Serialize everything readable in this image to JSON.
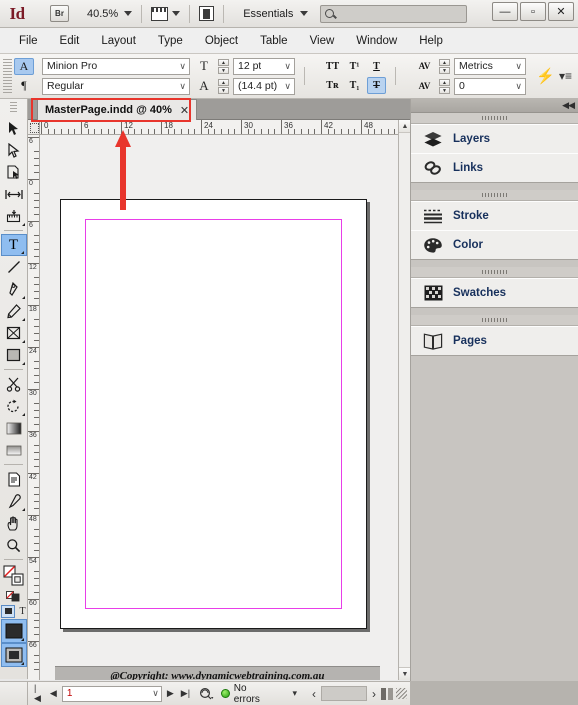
{
  "app": {
    "name": "Id",
    "bridge_label": "Br",
    "zoom_level": "40.5%",
    "workspace": "Essentials",
    "search_placeholder": ""
  },
  "window_controls": {
    "minimize": "—",
    "maximize": "▫",
    "close": "✕"
  },
  "menubar": {
    "items": [
      {
        "label": "File"
      },
      {
        "label": "Edit"
      },
      {
        "label": "Layout"
      },
      {
        "label": "Type"
      },
      {
        "label": "Object"
      },
      {
        "label": "Table"
      },
      {
        "label": "View"
      },
      {
        "label": "Window"
      },
      {
        "label": "Help"
      }
    ]
  },
  "control_panel": {
    "char_mode": "A",
    "para_mode": "¶",
    "font_family": "Minion Pro",
    "font_style": "Regular",
    "font_size": "12 pt",
    "leading": "(14.4 pt)",
    "size_glyph": "T",
    "leading_glyph": "A",
    "type_buttons_row1": [
      "TT",
      "T¹",
      "T"
    ],
    "type_buttons_row2": [
      "Tʀ",
      "T₁",
      "T"
    ],
    "kerning": "Metrics",
    "tracking": "0",
    "kern_glyph": "AV",
    "track_glyph": "AV",
    "quick_apply": "⚡",
    "panel_menu": "▾≡"
  },
  "document_tab": {
    "title": "MasterPage.indd @ 40%",
    "close": "✕",
    "highlighted": true,
    "highlight_color": "#e8352c"
  },
  "annotation": {
    "arrow_color": "#e8352c",
    "points_to": "document-tab"
  },
  "toolbox": {
    "groups": [
      {
        "tools": [
          {
            "name": "selection-tool",
            "glyph": "selection"
          },
          {
            "name": "direct-selection-tool",
            "glyph": "direct-selection"
          },
          {
            "name": "page-tool",
            "glyph": "page"
          },
          {
            "name": "gap-tool",
            "glyph": "gap"
          },
          {
            "name": "content-collector-tool",
            "glyph": "content-collector"
          }
        ]
      },
      {
        "tools": [
          {
            "name": "type-tool",
            "glyph": "T",
            "selected": true
          },
          {
            "name": "line-tool",
            "glyph": "line"
          },
          {
            "name": "pen-tool",
            "glyph": "pen"
          },
          {
            "name": "pencil-tool",
            "glyph": "pencil"
          },
          {
            "name": "frame-tool",
            "glyph": "frame"
          },
          {
            "name": "rectangle-tool",
            "glyph": "rectangle"
          }
        ]
      },
      {
        "tools": [
          {
            "name": "scissors-tool",
            "glyph": "scissors"
          },
          {
            "name": "rotate-tool",
            "glyph": "rotate"
          },
          {
            "name": "gradient-swatch-tool",
            "glyph": "gradient"
          },
          {
            "name": "gradient-feather-tool",
            "glyph": "gradient-feather"
          }
        ]
      },
      {
        "tools": [
          {
            "name": "note-tool",
            "glyph": "note"
          },
          {
            "name": "eyedropper-tool",
            "glyph": "eyedropper"
          },
          {
            "name": "hand-tool",
            "glyph": "hand"
          },
          {
            "name": "zoom-tool",
            "glyph": "zoom"
          }
        ]
      }
    ],
    "fill_stroke": {
      "name": "fill-stroke-control"
    },
    "formatting_affects": {
      "container": "▣",
      "text": "T"
    },
    "screen_mode_normal": {
      "name": "normal-mode-button",
      "selected": true
    },
    "screen_mode_preview": {
      "name": "preview-mode-button",
      "selected": true
    }
  },
  "rulers": {
    "units": "picas",
    "horizontal_labels": [
      "0",
      "6",
      "12",
      "18",
      "24",
      "30",
      "36",
      "42",
      "48"
    ],
    "vertical_labels": [
      "6",
      "0",
      "6",
      "12",
      "18",
      "24",
      "30",
      "36",
      "42",
      "48",
      "54",
      "60",
      "66"
    ]
  },
  "document": {
    "page_number": 1,
    "margin_guide_color": "#e83ee8",
    "footer_text": "@Copyright: www.dynamicwebtraining.com.au"
  },
  "statusbar": {
    "first_page": "|◀",
    "prev_page": "◀",
    "page_value": "1",
    "next_page": "▶",
    "last_page": "▶|",
    "preflight_icon": "preflight",
    "status_dot_color": "#2aa50f",
    "status_text": "No errors",
    "dropdown": "▾",
    "prev_arrow": "‹",
    "next_arrow": "›"
  },
  "dock": {
    "collapse_label": "◀◀",
    "groups": [
      {
        "panels": [
          {
            "label": "Layers",
            "icon": "layers-icon"
          },
          {
            "label": "Links",
            "icon": "links-icon"
          }
        ]
      },
      {
        "panels": [
          {
            "label": "Stroke",
            "icon": "stroke-icon"
          },
          {
            "label": "Color",
            "icon": "color-icon"
          }
        ]
      },
      {
        "panels": [
          {
            "label": "Swatches",
            "icon": "swatches-icon"
          }
        ]
      },
      {
        "panels": [
          {
            "label": "Pages",
            "icon": "pages-icon"
          }
        ]
      }
    ]
  }
}
